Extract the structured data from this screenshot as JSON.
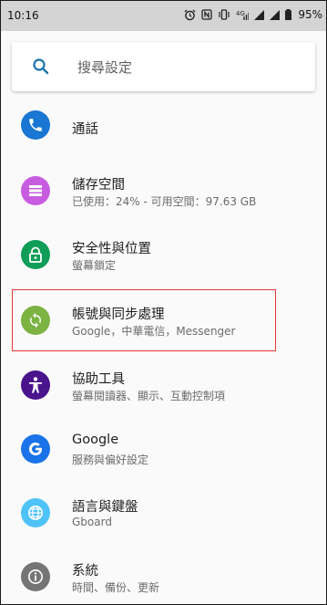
{
  "status_bar": {
    "time": "10:16",
    "battery": "95%",
    "icons": [
      "alarm-icon",
      "nfc-icon",
      "vibrate-icon",
      "data-4g-icon",
      "signal-icon",
      "signal-icon",
      "battery-icon"
    ]
  },
  "search": {
    "placeholder": "搜尋設定"
  },
  "items": [
    {
      "title": "通話",
      "subtitle": "",
      "icon": "phone-icon",
      "color": "#1976D2"
    },
    {
      "title": "儲存空間",
      "subtitle": "已使用：24% - 可用空間：97.63 GB",
      "icon": "storage-icon",
      "color": "#C85CE0"
    },
    {
      "title": "安全性與位置",
      "subtitle": "螢幕鎖定",
      "icon": "lock-icon",
      "color": "#0F9D58"
    },
    {
      "title": "帳號與同步處理",
      "subtitle": "Google，中華電信，Messenger",
      "icon": "sync-icon",
      "color": "#7CB342"
    },
    {
      "title": "協助工具",
      "subtitle": "螢幕閱讀器、顯示、互動控制項",
      "icon": "accessibility-icon",
      "color": "#4A148C"
    },
    {
      "title": "Google",
      "subtitle": "服務與偏好設定",
      "icon": "google-icon",
      "color": "#1A73E8"
    },
    {
      "title": "語言與鍵盤",
      "subtitle": "Gboard",
      "icon": "globe-icon",
      "color": "#4FC3F7"
    },
    {
      "title": "系統",
      "subtitle": "時間、備份、更新",
      "icon": "info-icon",
      "color": "#757575"
    }
  ]
}
